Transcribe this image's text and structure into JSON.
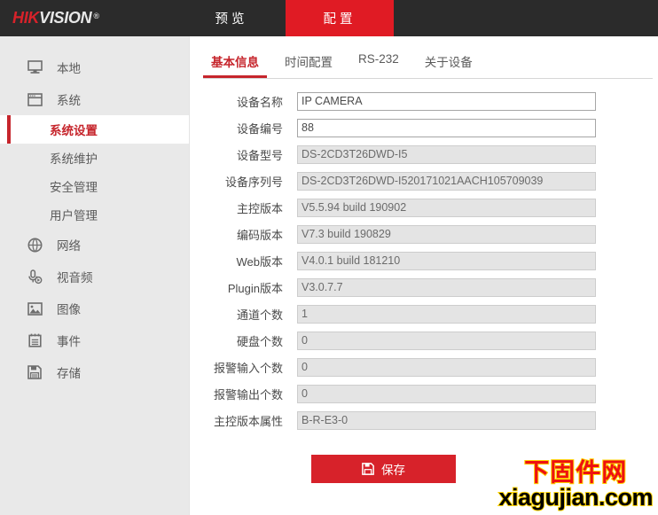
{
  "header": {
    "logo_hik": "HIK",
    "logo_vision": "VISION",
    "logo_reg": "®",
    "nav": [
      {
        "label": "预览",
        "name": "nav-tab-preview",
        "active": false
      },
      {
        "label": "配置",
        "name": "nav-tab-config",
        "active": true
      }
    ]
  },
  "sidebar": {
    "items": [
      {
        "label": "本地",
        "icon": "monitor-icon"
      },
      {
        "label": "系统",
        "icon": "window-icon"
      }
    ],
    "sub_items": [
      {
        "label": "系统设置",
        "active": true
      },
      {
        "label": "系统维护",
        "active": false
      },
      {
        "label": "安全管理",
        "active": false
      },
      {
        "label": "用户管理",
        "active": false
      }
    ],
    "items_after": [
      {
        "label": "网络",
        "icon": "globe-icon"
      },
      {
        "label": "视音频",
        "icon": "microphone-icon"
      },
      {
        "label": "图像",
        "icon": "image-icon"
      },
      {
        "label": "事件",
        "icon": "calendar-icon"
      },
      {
        "label": "存储",
        "icon": "floppy-icon"
      }
    ]
  },
  "content": {
    "tabs": [
      {
        "label": "基本信息",
        "active": true
      },
      {
        "label": "时间配置",
        "active": false
      },
      {
        "label": "RS-232",
        "active": false
      },
      {
        "label": "关于设备",
        "active": false
      }
    ],
    "fields": [
      {
        "label": "设备名称",
        "value": "IP CAMERA",
        "readonly": false
      },
      {
        "label": "设备编号",
        "value": "88",
        "readonly": false
      },
      {
        "label": "设备型号",
        "value": "DS-2CD3T26DWD-I5",
        "readonly": true
      },
      {
        "label": "设备序列号",
        "value": "DS-2CD3T26DWD-I520171021AACH105709039",
        "readonly": true
      },
      {
        "label": "主控版本",
        "value": "V5.5.94 build 190902",
        "readonly": true
      },
      {
        "label": "编码版本",
        "value": "V7.3 build 190829",
        "readonly": true
      },
      {
        "label": "Web版本",
        "value": "V4.0.1 build 181210",
        "readonly": true
      },
      {
        "label": "Plugin版本",
        "value": "V3.0.7.7",
        "readonly": true
      },
      {
        "label": "通道个数",
        "value": "1",
        "readonly": true
      },
      {
        "label": "硬盘个数",
        "value": "0",
        "readonly": true
      },
      {
        "label": "报警输入个数",
        "value": "0",
        "readonly": true
      },
      {
        "label": "报警输出个数",
        "value": "0",
        "readonly": true
      },
      {
        "label": "主控版本属性",
        "value": "B-R-E3-0",
        "readonly": true
      }
    ],
    "save_label": "保存"
  },
  "watermark": {
    "line1": "下固件网",
    "line2": "xiagujian.com"
  },
  "colors": {
    "brand_red": "#d7222a",
    "header_bg": "#2b2b2b",
    "sidebar_bg": "#e9e9e9",
    "accent_red": "#c6252c",
    "watermark_red": "#ee1111",
    "watermark_outline": "#ffd400"
  }
}
